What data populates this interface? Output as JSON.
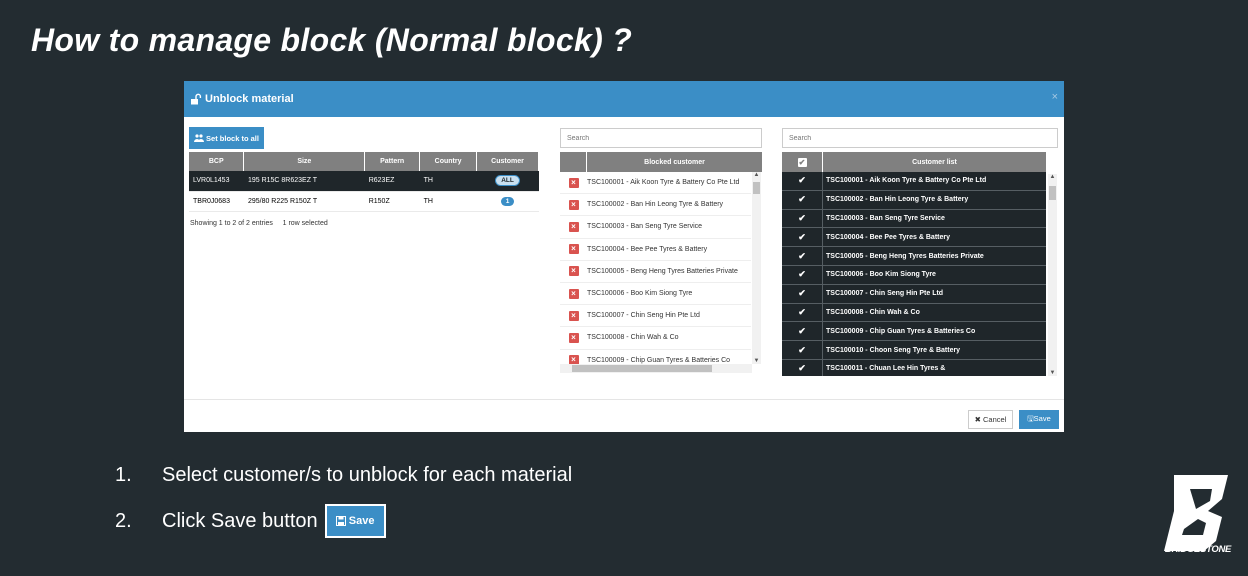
{
  "slide": {
    "title": "How to manage block (Normal block) ?",
    "steps": [
      {
        "num": "1.",
        "text": "Select customer/s to unblock for each material"
      },
      {
        "num": "2.",
        "text": "Click Save button"
      }
    ],
    "save_label": "Save",
    "brand": "BRIDGESTONE"
  },
  "modal": {
    "title": "Unblock material",
    "close": "×",
    "set_block_all": "Set block to all",
    "materials": {
      "headers": [
        "BCP",
        "Size",
        "Pattern",
        "Country",
        "Customer"
      ],
      "rows": [
        {
          "bcp": "LVR0L1453",
          "size": "195 R15C 8R623EZ T",
          "pattern": "R623EZ",
          "country": "TH",
          "customer": "ALL"
        },
        {
          "bcp": "TBR0J0683",
          "size": "295/80 R225 R150Z T",
          "pattern": "R150Z",
          "country": "TH",
          "customer": "1"
        }
      ],
      "info": "Showing 1 to 2 of 2 entries     1 row selected"
    },
    "blocked": {
      "search_placeholder": "Search",
      "header": "Blocked customer",
      "items": [
        "TSC100001 - Aik Koon Tyre & Battery Co Pte Ltd",
        "TSC100002 - Ban Hin Leong Tyre & Battery",
        "TSC100003 - Ban Seng Tyre Service",
        "TSC100004 - Bee Pee Tyres & Battery",
        "TSC100005 - Beng Heng Tyres Batteries Private",
        "TSC100006 - Boo Kim Siong Tyre",
        "TSC100007 - Chin Seng Hin Pte Ltd",
        "TSC100008 - Chin Wah & Co",
        "TSC100009 - Chip Guan Tyres & Batteries Co"
      ]
    },
    "customers": {
      "search_placeholder": "Search",
      "header": "Customer list",
      "items": [
        "TSC100001 - Aik Koon Tyre & Battery Co Pte Ltd",
        "TSC100002 - Ban Hin Leong Tyre & Battery",
        "TSC100003 - Ban Seng Tyre Service",
        "TSC100004 - Bee Pee Tyres & Battery",
        "TSC100005 - Beng Heng Tyres Batteries Private",
        "TSC100006 - Boo Kim Siong Tyre",
        "TSC100007 - Chin Seng Hin Pte Ltd",
        "TSC100008 - Chin Wah & Co",
        "TSC100009 - Chip Guan Tyres & Batteries Co",
        "TSC100010 - Choon Seng Tyre & Battery",
        "TSC100011 - Chuan Lee Hin Tyres &"
      ]
    },
    "cancel_label": "Cancel",
    "save_label": "Save"
  },
  "colors": {
    "accent": "#3b8ec6",
    "background": "#232c31",
    "danger": "#d9534f",
    "selected_row": "#1f262a"
  }
}
